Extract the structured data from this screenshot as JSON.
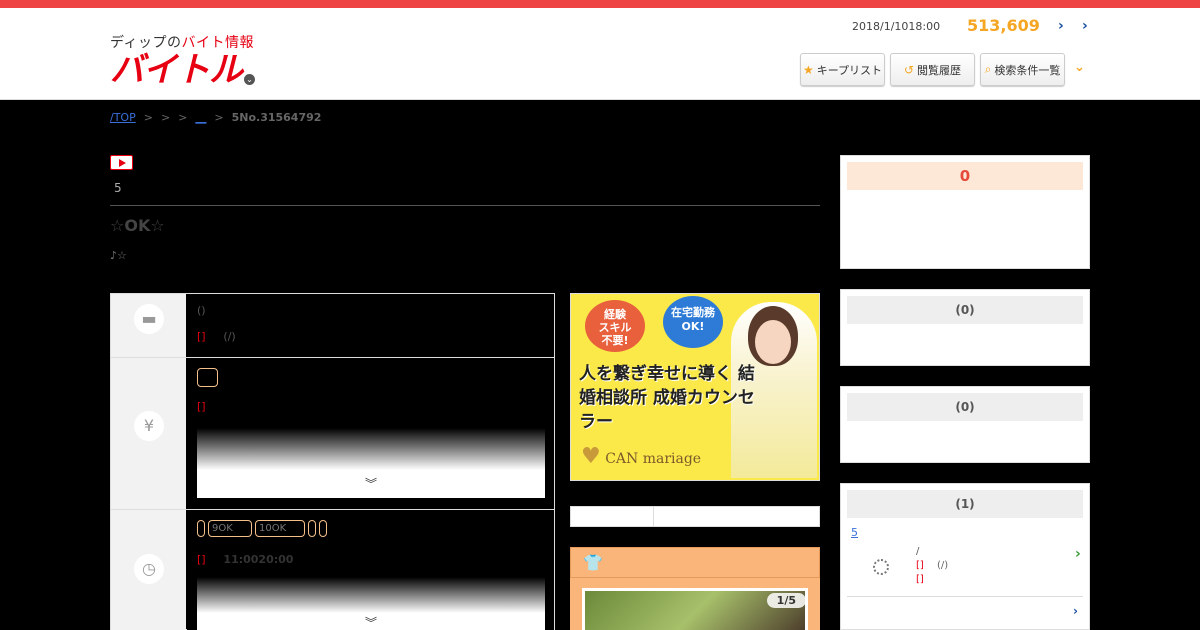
{
  "header": {
    "logo_sub_black": "ディップの",
    "logo_sub_red": "バイト情報",
    "logo_main": "バイトル",
    "chevron": "⌄",
    "datetime": "2018/1/1018:00",
    "count": "513,609",
    "arrow1": "›",
    "arrow2": "›",
    "buttons": [
      {
        "icon": "★",
        "label": "キープリスト"
      },
      {
        "icon": "↺",
        "label": "閲覧履歴"
      },
      {
        "icon": "⌕",
        "label": "検索条件一覧"
      }
    ],
    "more": "⌄"
  },
  "breadcrumb": {
    "top": "/TOP",
    "sep": ">",
    "link2": "__",
    "current": "5No.31564792"
  },
  "job": {
    "five": "5",
    "title": "☆OK☆",
    "subtitle": "♪☆"
  },
  "rows": [
    {
      "icon": "briefcase-icon",
      "glyph": "▬",
      "line1": "()",
      "tag": "[]",
      "line2": "(/)"
    },
    {
      "icon": "yen-icon",
      "glyph": "¥",
      "tag": "[]",
      "chev": "︾"
    },
    {
      "icon": "clock-icon",
      "glyph": "◷",
      "badge1": "9OK",
      "badge2": "10OK",
      "tag": "[]",
      "time": "11:0020:00",
      "chev": "︾"
    }
  ],
  "banner": {
    "bubble1": "経験\nスキル\n不要!",
    "bubble2": "在宅勤務\nOK!",
    "headline": "人を繋ぎ幸せに導く 結婚相談所 成婚カウンセラー",
    "logo": "CAN mariage"
  },
  "photo": {
    "count": "1/5"
  },
  "side": {
    "card1_head": "0",
    "card2_head": "(0)",
    "card3_head": "(0)",
    "card4_head": "(1)",
    "card4_link": "5",
    "card4_line1": "/",
    "card4_tag1": "[]",
    "card4_extra": "(/)",
    "card4_tag2": "[]",
    "card4_chev": "›",
    "card4_more": "›"
  }
}
